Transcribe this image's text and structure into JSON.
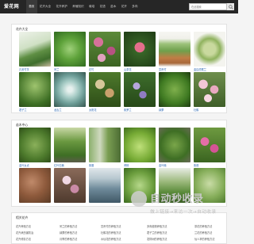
{
  "header": {
    "logo": "爱花网",
    "nav": [
      "首页",
      "花卉大全",
      "花卉养护",
      "养殖知识",
      "栽培",
      "花语",
      "苗木",
      "花卉",
      "多肉"
    ],
    "search_placeholder": "在此搜索"
  },
  "section1": {
    "title": "花卉大全",
    "items": [
      {
        "label": "孔雀竹芋"
      },
      {
        "label": "吊兰"
      },
      {
        "label": "石竹"
      },
      {
        "label": "山茶花"
      },
      {
        "label": "富贵竹"
      },
      {
        "label": "金边虎尾兰"
      },
      {
        "label": "君子兰"
      },
      {
        "label": "龙舌兰"
      },
      {
        "label": "太阳花"
      },
      {
        "label": "紫罗兰"
      },
      {
        "label": "绿萝"
      },
      {
        "label": "杜鹃"
      }
    ]
  },
  "section2": {
    "title": "苗木中心",
    "items": [
      {
        "label": "金叶女贞"
      },
      {
        "label": "红叶石楠"
      },
      {
        "label": "紫藤"
      },
      {
        "label": "黄杨"
      },
      {
        "label": "金叶榆"
      },
      {
        "label": "紫薇"
      },
      {
        "label": "红花檵木"
      },
      {
        "label": "丁香"
      },
      {
        "label": "凤尾兰"
      },
      {
        "label": "小叶黄杨"
      },
      {
        "label": "海桐"
      },
      {
        "label": "大叶黄杨"
      }
    ]
  },
  "section3": {
    "title": "相关花卉",
    "rows": [
      [
        "花卉养殖方法",
        "吊兰的养殖方法",
        "富贵竹的养殖方法",
        "多肉植物养殖方法",
        "茶花的养殖方法"
      ],
      [
        "花卉病虫害防治",
        "绿萝的养殖方法",
        "杜鹃花的养殖方法",
        "君子兰的养殖方法",
        "兰花的养殖方法"
      ],
      [
        "花卉修剪方法",
        "月季的养殖方法",
        "水仙花的养殖方法",
        "发财树的养殖方法",
        "仙人掌的养殖方法"
      ]
    ]
  },
  "watermark": {
    "title": "自动秒收录",
    "subtitle": "做上链接→来访一次→自动收录"
  }
}
